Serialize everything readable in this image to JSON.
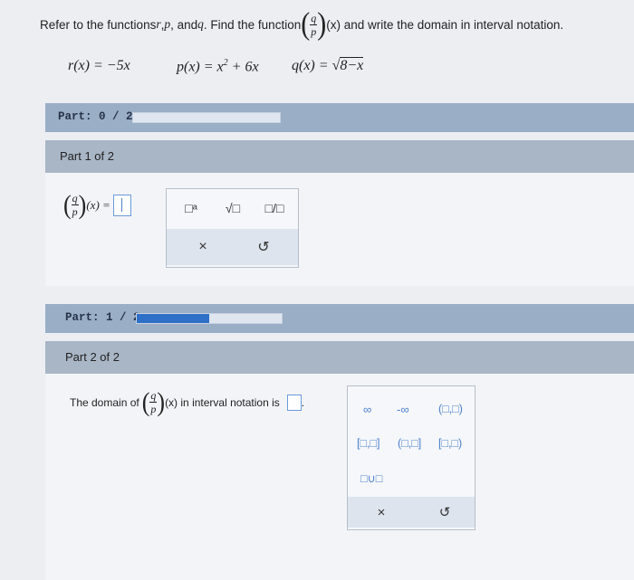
{
  "instruction": {
    "prefix": "Refer to the functions ",
    "r": "r",
    "comma1": ", ",
    "p": "p",
    "and": ", and ",
    "q": "q",
    "find": ". Find the function ",
    "frac_num": "q",
    "frac_den": "p",
    "suffix": "(x) and write the domain in interval notation."
  },
  "functions": {
    "r": "r(x) = −5x",
    "p_base": "p(x) = x",
    "p_exp": "2",
    "p_tail": " + 6x",
    "q_head": "q(x) = ",
    "q_radical": "√",
    "q_radicand": "8−x"
  },
  "part1_progress": {
    "label_prefix": "Part: ",
    "label_value": "0 / 2",
    "fraction": 0.0
  },
  "part1": {
    "heading": "Part 1 of 2",
    "lhs_num": "q",
    "lhs_den": "p",
    "lhs_tail": "(x) =",
    "palette": {
      "tool1": "□ᵃ",
      "tool2": "√□",
      "tool3": "□/□",
      "clear": "×",
      "undo": "↺"
    }
  },
  "part2_progress": {
    "label_prefix": "Part: ",
    "label_value": "1 / 2",
    "fraction": 0.5
  },
  "part2": {
    "heading": "Part 2 of 2",
    "prompt_before": "The domain of",
    "frac_num": "q",
    "frac_den": "p",
    "prompt_after": "(x) in interval notation is",
    "period": ".",
    "palette": {
      "infinity": "∞",
      "neg_infinity": "-∞",
      "open_open": "(□,□)",
      "closed_closed": "[□,□]",
      "open_closed": "(□,□]",
      "closed_open": "[□,□)",
      "union": "□∪□",
      "clear": "×",
      "undo": "↺"
    }
  },
  "colors": {
    "accent": "#2e6fc8",
    "bar": "#9aaec6",
    "header": "#a9b6c6"
  }
}
